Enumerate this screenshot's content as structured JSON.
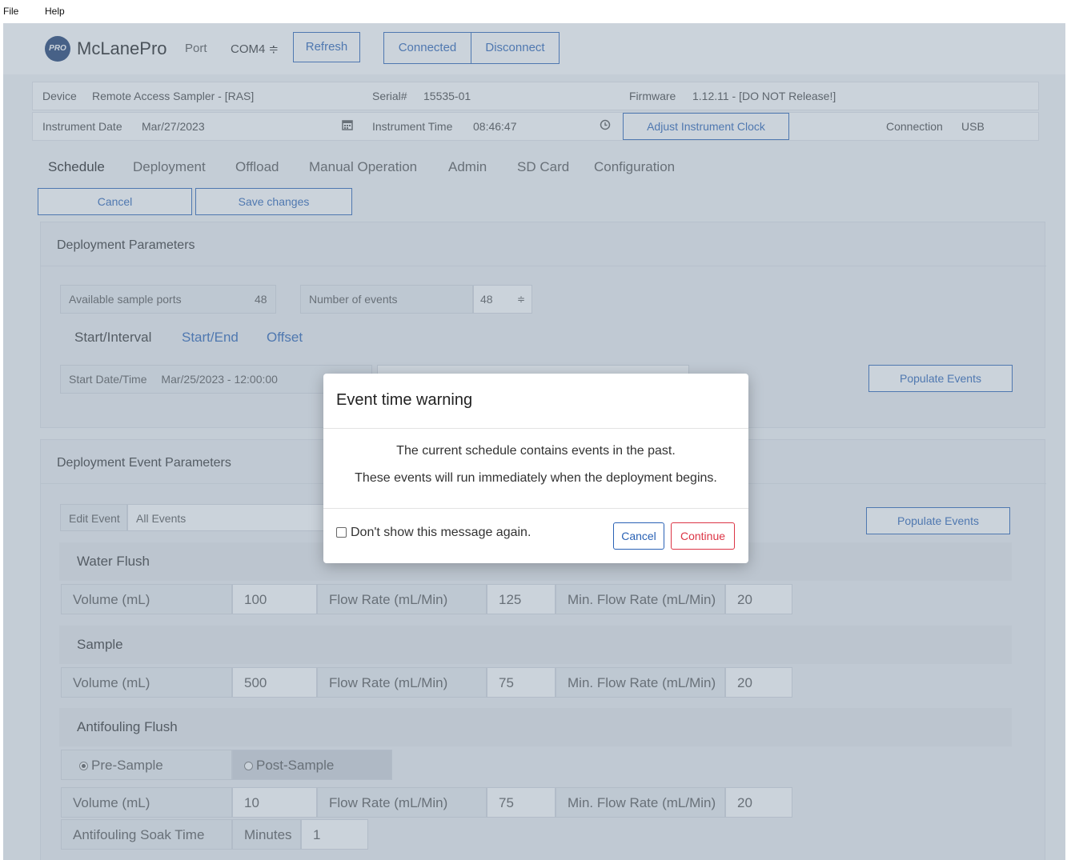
{
  "menu": {
    "file": "File",
    "help": "Help"
  },
  "header": {
    "logo_text": "PRO",
    "brand": "McLanePro",
    "port_label": "Port",
    "port_value": "COM4 ≑",
    "refresh": "Refresh",
    "connected": "Connected",
    "disconnect": "Disconnect"
  },
  "device_info": {
    "device_label": "Device",
    "device_value": "Remote Access Sampler - [RAS]",
    "serial_label": "Serial#",
    "serial_value": "15535-01",
    "firmware_label": "Firmware",
    "firmware_value": "1.12.11 - [DO NOT Release!]",
    "date_label": "Instrument Date",
    "date_value": "Mar/27/2023",
    "time_label": "Instrument Time",
    "time_value": "08:46:47",
    "adjust_clock": "Adjust Instrument Clock",
    "connection_label": "Connection",
    "connection_value": "USB"
  },
  "tabs": [
    "Schedule",
    "Deployment",
    "Offload",
    "Manual Operation",
    "Admin",
    "SD Card",
    "Configuration"
  ],
  "actions": {
    "cancel": "Cancel",
    "save": "Save changes"
  },
  "deployment_params": {
    "title": "Deployment Parameters",
    "ports_label": "Available sample ports",
    "ports_value": "48",
    "events_label": "Number of events",
    "events_value": "48",
    "subtabs": [
      "Start/Interval",
      "Start/End",
      "Offset"
    ],
    "start_label": "Start Date/Time",
    "start_value": "Mar/25/2023 - 12:00:00",
    "populate": "Populate Events"
  },
  "event_params": {
    "title": "Deployment Event Parameters",
    "edit_event": "Edit Event",
    "all_events": "All Events",
    "populate": "Populate Events",
    "volume_label": "Volume (mL)",
    "flow_label": "Flow Rate (mL/Min)",
    "min_flow_label": "Min. Flow Rate (mL/Min)",
    "water_flush": {
      "title": "Water Flush",
      "volume": "100",
      "flow": "125",
      "min_flow": "20"
    },
    "sample": {
      "title": "Sample",
      "volume": "500",
      "flow": "75",
      "min_flow": "20"
    },
    "antifouling": {
      "title": "Antifouling Flush",
      "pre": "Pre-Sample",
      "post": "Post-Sample",
      "volume": "10",
      "flow": "75",
      "min_flow": "20",
      "soak_label": "Antifouling Soak Time",
      "minutes_label": "Minutes",
      "minutes_value": "1"
    }
  },
  "modal": {
    "title": "Event time warning",
    "line1": "The current schedule contains events in the past.",
    "line2": "These events will run immediately when the deployment begins.",
    "checkbox_label": "Don't show this message again.",
    "cancel": "Cancel",
    "continue": "Continue"
  },
  "colors": {
    "accent": "#2a62b5",
    "danger": "#dc3545",
    "overlay": "rgba(130,150,170,0.42)"
  }
}
